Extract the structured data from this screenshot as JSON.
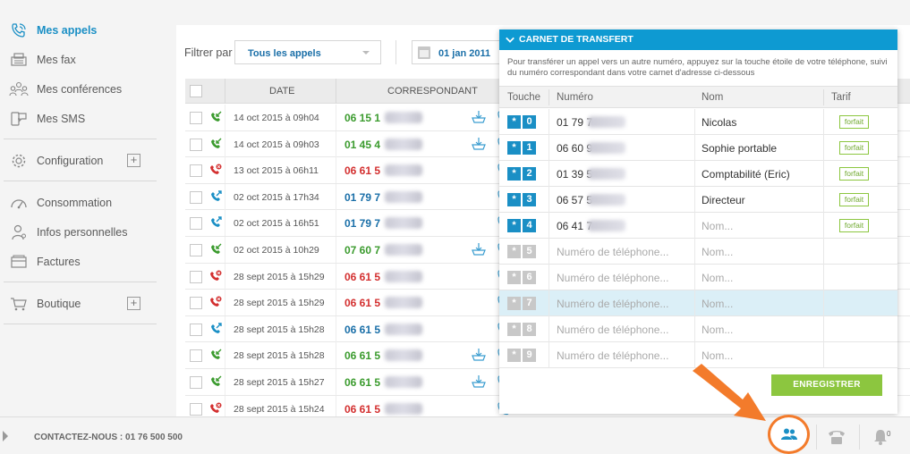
{
  "sidebar": {
    "items": [
      {
        "label": "Mes appels",
        "icon": "phone-icon"
      },
      {
        "label": "Mes fax",
        "icon": "fax-icon"
      },
      {
        "label": "Mes conférences",
        "icon": "conference-icon"
      },
      {
        "label": "Mes SMS",
        "icon": "sms-icon"
      },
      {
        "label": "Configuration",
        "icon": "gear-icon"
      },
      {
        "label": "Consommation",
        "icon": "gauge-icon"
      },
      {
        "label": "Infos personnelles",
        "icon": "user-icon"
      },
      {
        "label": "Factures",
        "icon": "invoice-icon"
      },
      {
        "label": "Boutique",
        "icon": "cart-icon"
      }
    ],
    "plus": "+"
  },
  "filter": {
    "label": "Filtrer par",
    "value": "Tous les appels",
    "date": "01 jan 2011"
  },
  "table": {
    "headers": {
      "date": "DATE",
      "correspondant": "CORRESPONDANT"
    },
    "rows": [
      {
        "type": "received",
        "date": "14 oct 2015 à 09h04",
        "number": "06 15 1",
        "color": "green",
        "download": true
      },
      {
        "type": "received",
        "date": "14 oct 2015 à 09h03",
        "number": "01 45 4",
        "color": "green",
        "download": true
      },
      {
        "type": "missed",
        "date": "13 oct 2015 à 06h11",
        "number": "06 61 5",
        "color": "red",
        "download": false
      },
      {
        "type": "outgoing",
        "date": "02 oct 2015 à 17h34",
        "number": "01 79 7",
        "color": "blue",
        "download": false
      },
      {
        "type": "outgoing",
        "date": "02 oct 2015 à 16h51",
        "number": "01 79 7",
        "color": "blue",
        "download": false
      },
      {
        "type": "received",
        "date": "02 oct 2015 à 10h29",
        "number": "07 60 7",
        "color": "green",
        "download": true
      },
      {
        "type": "missed",
        "date": "28 sept 2015 à 15h29",
        "number": "06 61 5",
        "color": "red",
        "download": false
      },
      {
        "type": "missed",
        "date": "28 sept 2015 à 15h29",
        "number": "06 61 5",
        "color": "red",
        "download": false
      },
      {
        "type": "outgoing",
        "date": "28 sept 2015 à 15h28",
        "number": "06 61 5",
        "color": "blue",
        "download": false
      },
      {
        "type": "received",
        "date": "28 sept 2015 à 15h28",
        "number": "06 61 5",
        "color": "green",
        "download": true
      },
      {
        "type": "received",
        "date": "28 sept 2015 à 15h27",
        "number": "06 61 5",
        "color": "green",
        "download": true
      },
      {
        "type": "missed",
        "date": "28 sept 2015 à 15h24",
        "number": "06 61 5",
        "color": "red",
        "download": false
      }
    ]
  },
  "transfer": {
    "title": "CARNET DE TRANSFERT",
    "description": "Pour transférer un appel vers un autre numéro, appuyez sur la touche étoile de votre téléphone, suivi du numéro correspondant dans votre carnet d'adresse ci-dessous",
    "headers": {
      "touche": "Touche",
      "numero": "Numéro",
      "nom": "Nom",
      "tarif": "Tarif"
    },
    "star": "*",
    "rows": [
      {
        "key": "0",
        "number": "01 79 7",
        "name": "Nicolas",
        "tarif": "forfait",
        "filled": true
      },
      {
        "key": "1",
        "number": "06 60 9",
        "name": "Sophie portable",
        "tarif": "forfait",
        "filled": true
      },
      {
        "key": "2",
        "number": "01 39 5",
        "name": "Comptabilité (Eric)",
        "tarif": "forfait",
        "filled": true
      },
      {
        "key": "3",
        "number": "06 57 5",
        "name": "Directeur",
        "tarif": "forfait",
        "filled": true
      },
      {
        "key": "4",
        "number": "06 41 7",
        "name": "Nom...",
        "tarif": "forfait",
        "filled": true
      },
      {
        "key": "5",
        "number": "Numéro de téléphone...",
        "name": "Nom...",
        "tarif": "",
        "filled": false
      },
      {
        "key": "6",
        "number": "Numéro de téléphone...",
        "name": "Nom...",
        "tarif": "",
        "filled": false
      },
      {
        "key": "7",
        "number": "Numéro de téléphone...",
        "name": "Nom...",
        "tarif": "",
        "filled": false
      },
      {
        "key": "8",
        "number": "Numéro de téléphone...",
        "name": "Nom...",
        "tarif": "",
        "filled": false
      },
      {
        "key": "9",
        "number": "Numéro de téléphone...",
        "name": "Nom...",
        "tarif": "",
        "filled": false
      }
    ],
    "highlighted_key": "7",
    "save": "ENREGISTRER"
  },
  "footer": {
    "contact": "CONTACTEZ-NOUS : 01 76 500 500",
    "notifications": "0"
  },
  "colors": {
    "accent": "#0e9ad2",
    "green": "#3b9b2e",
    "red": "#d32f2f",
    "blue": "#1a6fa8",
    "save": "#8cc63f",
    "highlight": "#f37b2b"
  }
}
